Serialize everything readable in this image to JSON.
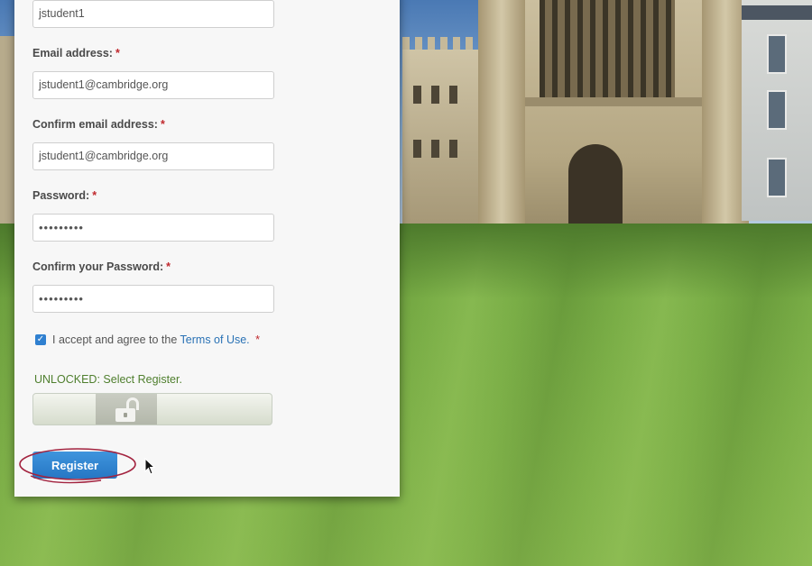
{
  "form": {
    "username": {
      "value": "jstudent1"
    },
    "email": {
      "label": "Email address:",
      "required_mark": "*",
      "value": "jstudent1@cambridge.org"
    },
    "confirm_email": {
      "label": "Confirm email address:",
      "required_mark": "*",
      "value": "jstudent1@cambridge.org"
    },
    "password": {
      "label": "Password:",
      "required_mark": "*",
      "value": "•••••••••"
    },
    "confirm_password": {
      "label": "Confirm your Password:",
      "required_mark": "*",
      "value": "•••••••••"
    },
    "terms": {
      "checked": true,
      "prefix": "I accept and agree to the",
      "link_text": "Terms of Use.",
      "required_mark": "*"
    },
    "unlock_message": "UNLOCKED: Select Register.",
    "slider_icon": "unlocked-padlock-icon",
    "register_label": "Register"
  },
  "colors": {
    "required": "#c0282d",
    "link": "#2a72b5",
    "unlock_text": "#4f7f2e",
    "button": "#2f86d2",
    "annotation": "#a3233f"
  }
}
